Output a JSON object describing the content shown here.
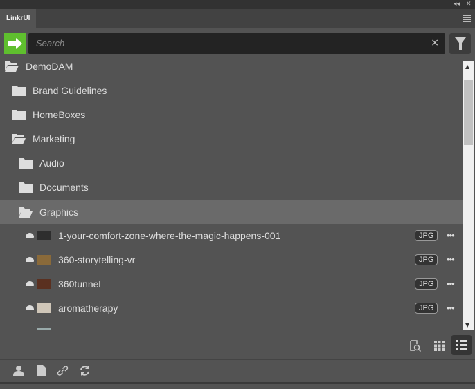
{
  "window": {
    "tab": "LinkrUI",
    "collapse_icon": "double-chevron-left-icon",
    "close_icon": "close-icon"
  },
  "search": {
    "placeholder": "Search",
    "value": ""
  },
  "tree": [
    {
      "label": "DemoDAM",
      "icon": "folder-open-icon",
      "level": 0
    },
    {
      "label": "Brand Guidelines",
      "icon": "folder-icon",
      "level": 1
    },
    {
      "label": "HomeBoxes",
      "icon": "folder-icon",
      "level": 1
    },
    {
      "label": "Marketing",
      "icon": "folder-open-icon",
      "level": 1
    },
    {
      "label": "Audio",
      "icon": "folder-icon",
      "level": 2
    },
    {
      "label": "Documents",
      "icon": "folder-icon",
      "level": 2
    },
    {
      "label": "Graphics",
      "icon": "folder-open-icon",
      "level": 2,
      "selected": true
    }
  ],
  "assets": [
    {
      "name": "1-your-comfort-zone-where-the-magic-happens-001",
      "type": "JPG",
      "thumb": "#2e2e2e"
    },
    {
      "name": "360-storytelling-vr",
      "type": "JPG",
      "thumb": "#8a6a3a"
    },
    {
      "name": "360tunnel",
      "type": "JPG",
      "thumb": "#5a3020"
    },
    {
      "name": "aromatherapy",
      "type": "JPG",
      "thumb": "#cfc6b8"
    }
  ],
  "colors": {
    "accent": "#5fbf2e",
    "selected": "#6a6a6a",
    "background": "#535353"
  }
}
